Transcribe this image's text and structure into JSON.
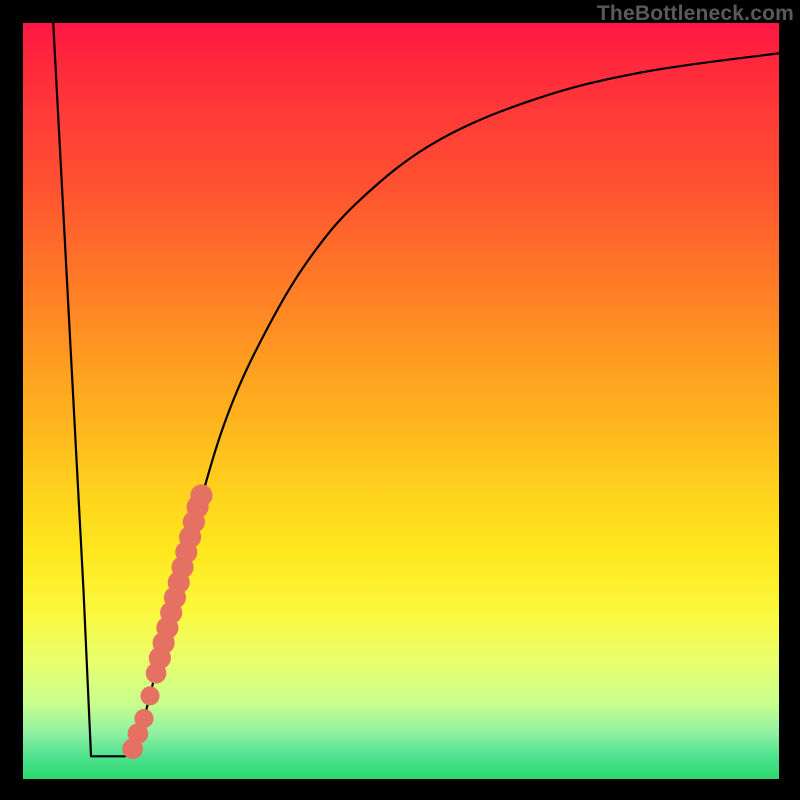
{
  "watermark": "TheBottleneck.com",
  "colors": {
    "curve_stroke": "#000000",
    "marker_fill": "#e57163",
    "frame_bg": "#000000"
  },
  "chart_data": {
    "type": "line",
    "title": "",
    "xlabel": "",
    "ylabel": "",
    "xlim": [
      0,
      100
    ],
    "ylim": [
      0,
      100
    ],
    "grid": false,
    "legend": false,
    "series": [
      {
        "name": "bottleneck-curve",
        "x": [
          4,
          8,
          9,
          10,
          13.5,
          14.5,
          16,
          19,
          23,
          27,
          32,
          38,
          45,
          55,
          68,
          82,
          100
        ],
        "y": [
          100,
          25,
          3,
          3,
          3,
          4,
          8,
          20,
          35,
          48,
          59,
          69,
          77,
          84.5,
          90,
          93.5,
          96
        ]
      }
    ],
    "markers": [
      {
        "x": 14.5,
        "y": 4,
        "r": 1.1
      },
      {
        "x": 15.2,
        "y": 6,
        "r": 1.1
      },
      {
        "x": 16.0,
        "y": 8,
        "r": 1.0
      },
      {
        "x": 16.8,
        "y": 11,
        "r": 1.0
      },
      {
        "x": 17.6,
        "y": 14,
        "r": 1.1
      },
      {
        "x": 18.1,
        "y": 16,
        "r": 1.2
      },
      {
        "x": 18.6,
        "y": 18,
        "r": 1.2
      },
      {
        "x": 19.1,
        "y": 20,
        "r": 1.2
      },
      {
        "x": 19.6,
        "y": 22,
        "r": 1.2
      },
      {
        "x": 20.1,
        "y": 24,
        "r": 1.2
      },
      {
        "x": 20.6,
        "y": 26,
        "r": 1.2
      },
      {
        "x": 21.1,
        "y": 28,
        "r": 1.2
      },
      {
        "x": 21.6,
        "y": 30,
        "r": 1.2
      },
      {
        "x": 22.1,
        "y": 32,
        "r": 1.2
      },
      {
        "x": 22.6,
        "y": 34,
        "r": 1.2
      },
      {
        "x": 23.1,
        "y": 36,
        "r": 1.2
      },
      {
        "x": 23.6,
        "y": 37.5,
        "r": 1.2
      }
    ]
  }
}
